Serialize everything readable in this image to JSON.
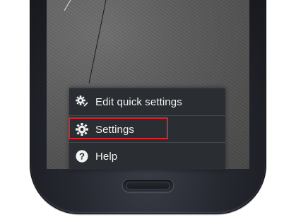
{
  "menu": {
    "items": [
      {
        "label": "Edit quick settings",
        "icon": "gear-edit-icon"
      },
      {
        "label": "Settings",
        "icon": "gear-icon",
        "highlighted": true
      },
      {
        "label": "Help",
        "icon": "help-icon"
      }
    ]
  },
  "colors": {
    "menu_background": "#2a2d31",
    "menu_text": "#f2f2f2",
    "highlight_border": "#d9232d",
    "phone_body": "#262830"
  }
}
